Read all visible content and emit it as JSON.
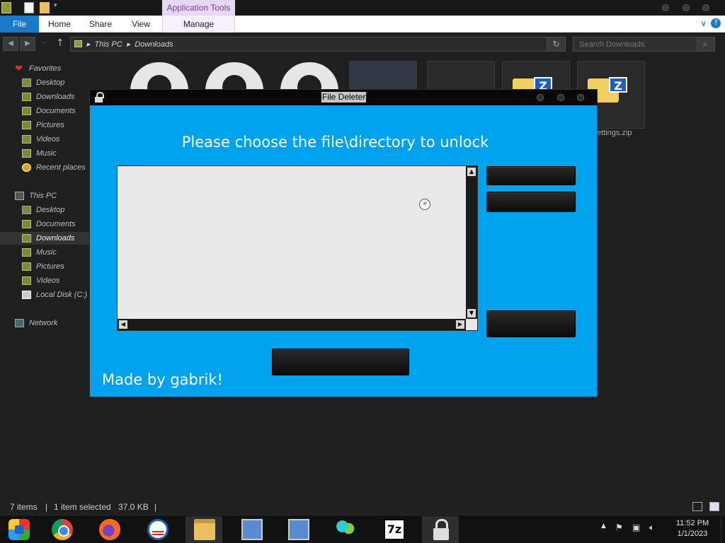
{
  "explorer": {
    "context_tab_header": "Application Tools",
    "ribbon_tabs": [
      "File",
      "Home",
      "Share",
      "View"
    ],
    "context_tab": "Manage",
    "breadcrumb": [
      "This PC",
      "Downloads"
    ],
    "search_placeholder": "Search Downloads",
    "nav": {
      "favorites_header": "Favorites",
      "favorites": [
        "Desktop",
        "Downloads",
        "Documents",
        "Pictures",
        "Videos",
        "Music",
        "Recent places"
      ],
      "thispc_header": "This PC",
      "thispc": [
        "Desktop",
        "Documents",
        "Downloads",
        "Music",
        "Pictures",
        "Videos",
        "Local Disk (C:)"
      ],
      "network": "Network"
    },
    "visible_file_caption": "ettings.zip",
    "status": {
      "items": "7 items",
      "selected": "1 item selected",
      "size": "37.0 KB"
    }
  },
  "file_deleter": {
    "title": "File Deleter",
    "prompt": "Please choose the file\\directory to unlock",
    "credit": "Made by gabrik!",
    "button_labels": [
      "",
      "",
      "",
      ""
    ],
    "colors": {
      "background": "#00a2ed",
      "buttons": "#111111"
    }
  },
  "taskbar": {
    "apps": [
      "start-icon",
      "chrome-icon",
      "firefox-icon",
      "obama-logo-icon",
      "file-explorer-icon",
      "setup-icon",
      "setup-icon",
      "people-icon",
      "7zip-icon",
      "lock-icon"
    ],
    "time": "11:52 PM",
    "date": "1/1/2023"
  }
}
